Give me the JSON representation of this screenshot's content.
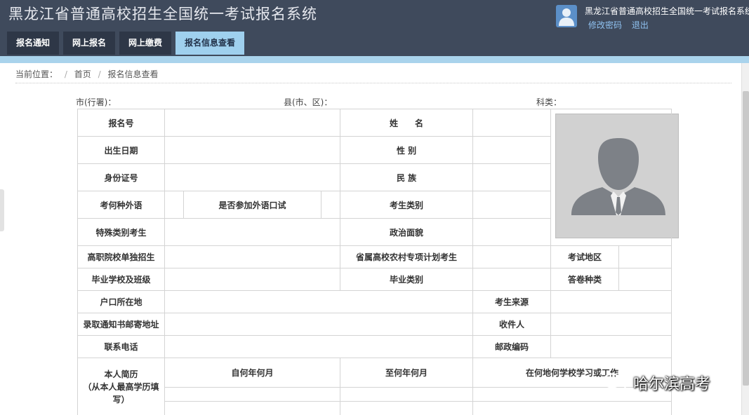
{
  "header": {
    "title": "黑龙江省普通高校招生全国统一考试报名系统",
    "user_name": "黑龙江省普通高校招生全国统一考试报名系统",
    "change_password": "修改密码",
    "logout": "退出"
  },
  "nav": {
    "tabs": [
      {
        "label": "报名通知",
        "active": false
      },
      {
        "label": "网上报名",
        "active": false
      },
      {
        "label": "网上缴费",
        "active": false
      },
      {
        "label": "报名信息查看",
        "active": true
      }
    ]
  },
  "breadcrumb": {
    "prefix": "当前位置：",
    "home": "首页",
    "current": "报名信息查看"
  },
  "meta": {
    "city": "市(行署)：",
    "county": "县(市、区)：",
    "subject": "科类："
  },
  "form": {
    "reg_no": "报名号",
    "name": "姓　　名",
    "birth": "出生日期",
    "gender": "性  别",
    "id_no": "身份证号",
    "ethnicity": "民  族",
    "foreign_lang": "考何种外语",
    "oral_exam": "是否参加外语口试",
    "candidate_type": "考生类别",
    "special_type": "特殊类别考生",
    "political": "政治面貌",
    "vocational": "高职院校单独招生",
    "rural_plan": "省属高校农村专项计划考生",
    "exam_area": "考试地区",
    "grad_school": "毕业学校及班级",
    "grad_type": "毕业类别",
    "paper_type": "答卷种类",
    "hukou": "户口所在地",
    "source": "考生来源",
    "mail_addr": "录取通知书邮寄地址",
    "receiver": "收件人",
    "phone": "联系电话",
    "postcode": "邮政编码",
    "resume_title": "本人简历",
    "resume_note": "（从本人最高学历填写）",
    "from_date": "自何年何月",
    "to_date": "至何年何月",
    "where": "在何地何学校学习或工作"
  },
  "watermark": {
    "text": "哈尔滨高考"
  },
  "colors": {
    "header_bg": "#3f4a5c",
    "tab_bg": "#2e3747",
    "tab_active_bg": "#9fd0ee",
    "strip": "#a9d3ec",
    "link": "#8fc1f0"
  }
}
